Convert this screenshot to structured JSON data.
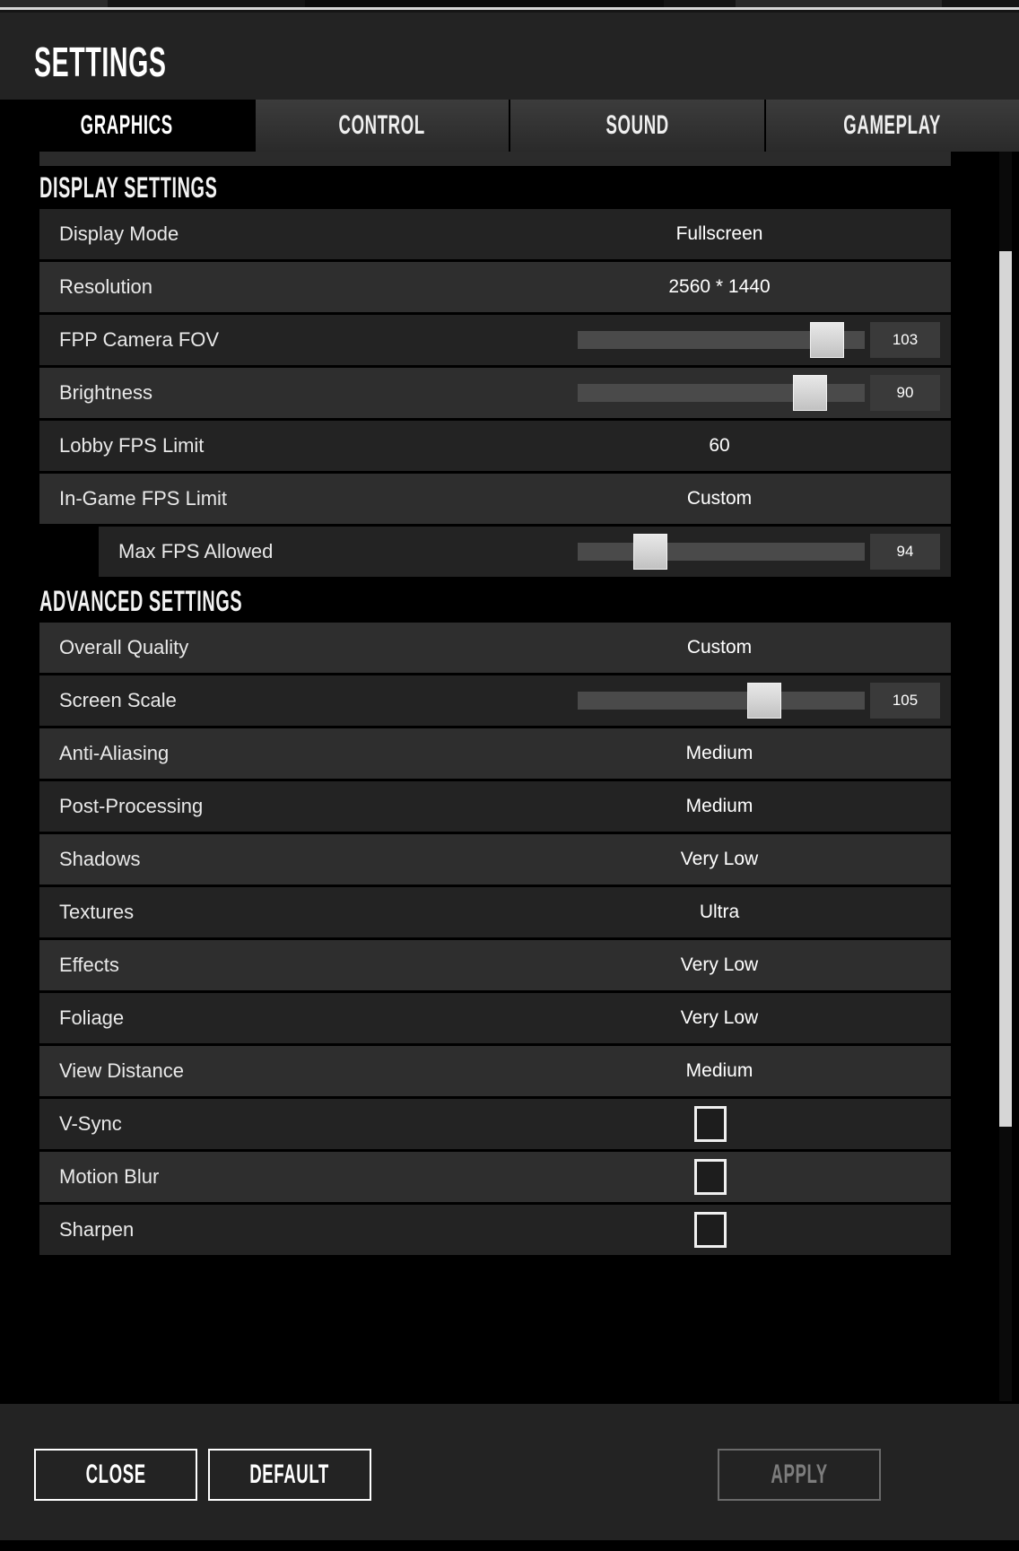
{
  "window": {
    "title": "SETTINGS"
  },
  "tabs": [
    {
      "label": "GRAPHICS",
      "active": true
    },
    {
      "label": "CONTROL",
      "active": false
    },
    {
      "label": "SOUND",
      "active": false
    },
    {
      "label": "GAMEPLAY",
      "active": false
    }
  ],
  "sections": [
    {
      "id": "display-settings",
      "title": "DISPLAY SETTINGS",
      "rows": [
        {
          "id": "display-mode",
          "label": "Display Mode",
          "type": "value",
          "value": "Fullscreen"
        },
        {
          "id": "resolution",
          "label": "Resolution",
          "type": "value",
          "value": "2560 * 1440"
        },
        {
          "id": "fpp-camera-fov",
          "label": "FPP Camera FOV",
          "type": "slider",
          "value": "103",
          "percent": 92
        },
        {
          "id": "brightness",
          "label": "Brightness",
          "type": "slider",
          "value": "90",
          "percent": 85
        },
        {
          "id": "lobby-fps-limit",
          "label": "Lobby FPS Limit",
          "type": "value",
          "value": "60"
        },
        {
          "id": "ingame-fps-limit",
          "label": "In-Game FPS Limit",
          "type": "value",
          "value": "Custom"
        },
        {
          "id": "max-fps-allowed",
          "label": "Max FPS Allowed",
          "type": "slider",
          "value": "94",
          "percent": 22,
          "indent": true
        }
      ]
    },
    {
      "id": "advanced-settings",
      "title": "ADVANCED SETTINGS",
      "rows": [
        {
          "id": "overall-quality",
          "label": "Overall Quality",
          "type": "value",
          "value": "Custom"
        },
        {
          "id": "screen-scale",
          "label": "Screen Scale",
          "type": "slider",
          "value": "105",
          "percent": 67
        },
        {
          "id": "anti-aliasing",
          "label": "Anti-Aliasing",
          "type": "value",
          "value": "Medium"
        },
        {
          "id": "post-processing",
          "label": "Post-Processing",
          "type": "value",
          "value": "Medium"
        },
        {
          "id": "shadows",
          "label": "Shadows",
          "type": "value",
          "value": "Very Low"
        },
        {
          "id": "textures",
          "label": "Textures",
          "type": "value",
          "value": "Ultra"
        },
        {
          "id": "effects",
          "label": "Effects",
          "type": "value",
          "value": "Very Low"
        },
        {
          "id": "foliage",
          "label": "Foliage",
          "type": "value",
          "value": "Very Low"
        },
        {
          "id": "view-distance",
          "label": "View Distance",
          "type": "value",
          "value": "Medium"
        },
        {
          "id": "v-sync",
          "label": "V-Sync",
          "type": "checkbox",
          "checked": false
        },
        {
          "id": "motion-blur",
          "label": "Motion Blur",
          "type": "checkbox",
          "checked": false
        },
        {
          "id": "sharpen",
          "label": "Sharpen",
          "type": "checkbox",
          "checked": false
        }
      ]
    }
  ],
  "scrollbar": {
    "thumb_top_percent": 8,
    "thumb_height_percent": 70
  },
  "footer": {
    "buttons": [
      {
        "id": "close",
        "label": "CLOSE",
        "enabled": true
      },
      {
        "id": "default",
        "label": "DEFAULT",
        "enabled": true
      },
      {
        "id": "apply",
        "label": "APPLY",
        "enabled": false
      }
    ]
  },
  "colors": {
    "background": "#000000",
    "panel": "#232323",
    "row_dark": "#232323",
    "row_light": "#2e2e2e",
    "slider_track": "#4a4a4a",
    "slider_handle": "#d9d9d9",
    "text": "#ffffff",
    "disabled_text": "#7d7d7d"
  }
}
